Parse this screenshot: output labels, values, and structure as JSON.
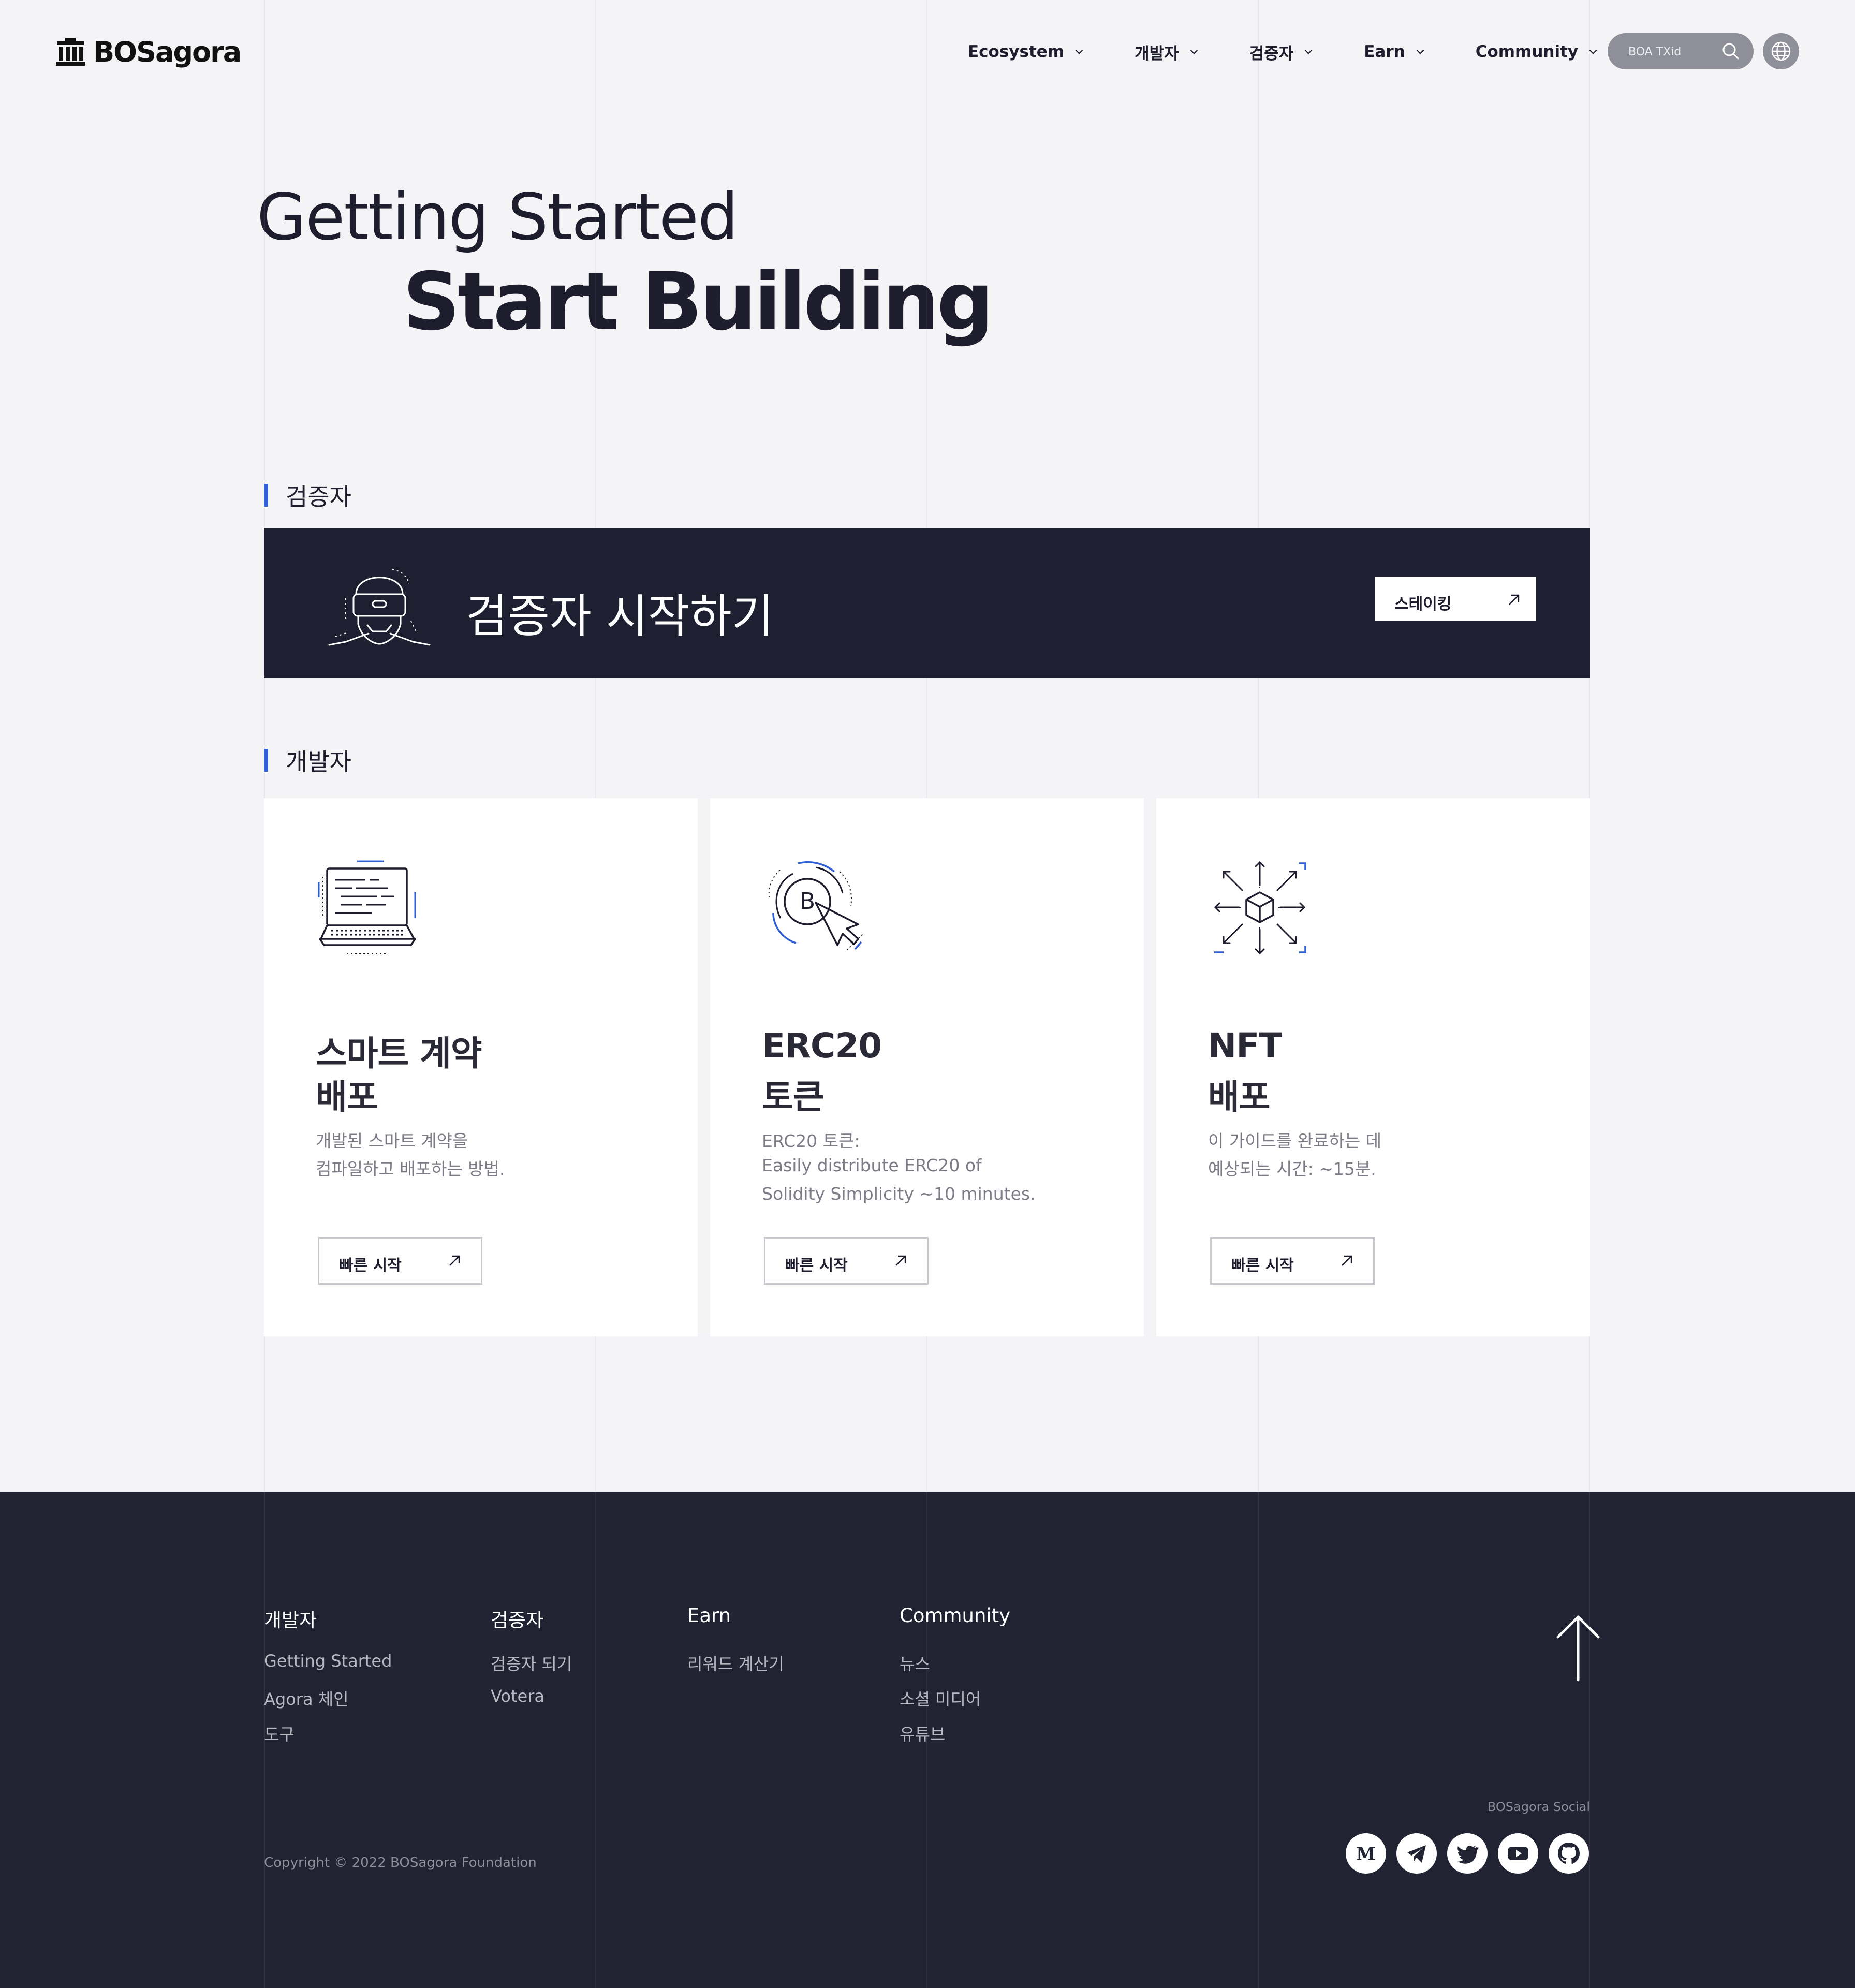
{
  "header": {
    "logo_text": "BOSagora",
    "nav": [
      {
        "label": "Ecosystem"
      },
      {
        "label": "개발자"
      },
      {
        "label": "검증자"
      },
      {
        "label": "Earn"
      },
      {
        "label": "Community"
      }
    ],
    "search_placeholder": "BOA TXid"
  },
  "hero": {
    "line1": "Getting Started",
    "line2": "Start Building"
  },
  "validator": {
    "section_label": "검증자",
    "banner_title": "검증자 시작하기",
    "button_label": "스테이킹"
  },
  "developer": {
    "section_label": "개발자",
    "cards": [
      {
        "title_line1": "스마트 계약",
        "title_line2": "배포",
        "desc_line1": "개발된 스마트 계약을",
        "desc_line2": "컴파일하고 배포하는 방법.",
        "desc_line3": "",
        "button_label": "빠른 시작",
        "icon": "laptop-code-icon"
      },
      {
        "title_line1": "ERC20",
        "title_line2": "토큰",
        "desc_line1": "ERC20 토큰:",
        "desc_line2": "Easily distribute ERC20 of",
        "desc_line3": "Solidity Simplicity ~10 minutes.",
        "button_label": "빠른 시작",
        "icon": "token-click-icon"
      },
      {
        "title_line1": "NFT",
        "title_line2": "배포",
        "desc_line1": "이 가이드를 완료하는 데",
        "desc_line2": "예상되는 시간: ~15분.",
        "desc_line3": "",
        "button_label": "빠른 시작",
        "icon": "cube-expand-icon"
      }
    ]
  },
  "footer": {
    "columns": [
      {
        "heading": "개발자",
        "links": [
          "Getting Started",
          "Agora 체인",
          "도구"
        ]
      },
      {
        "heading": "검증자",
        "links": [
          "검증자 되기",
          "Votera"
        ]
      },
      {
        "heading": "Earn",
        "links": [
          "리워드 계산기"
        ]
      },
      {
        "heading": "Community",
        "links": [
          "뉴스",
          "소셜 미디어",
          "유튜브"
        ]
      }
    ],
    "social_label": "BOSagora Social",
    "socials": [
      "medium-icon",
      "telegram-icon",
      "twitter-icon",
      "youtube-icon",
      "github-icon"
    ],
    "copyright": "Copyright © 2022 BOSagora Foundation"
  },
  "colors": {
    "page_bg": "#f4f4f6",
    "dark": "#1e1f31",
    "footer_bg": "#222332",
    "accent": "#2f5fd4",
    "search_bg": "#8e8f99"
  }
}
